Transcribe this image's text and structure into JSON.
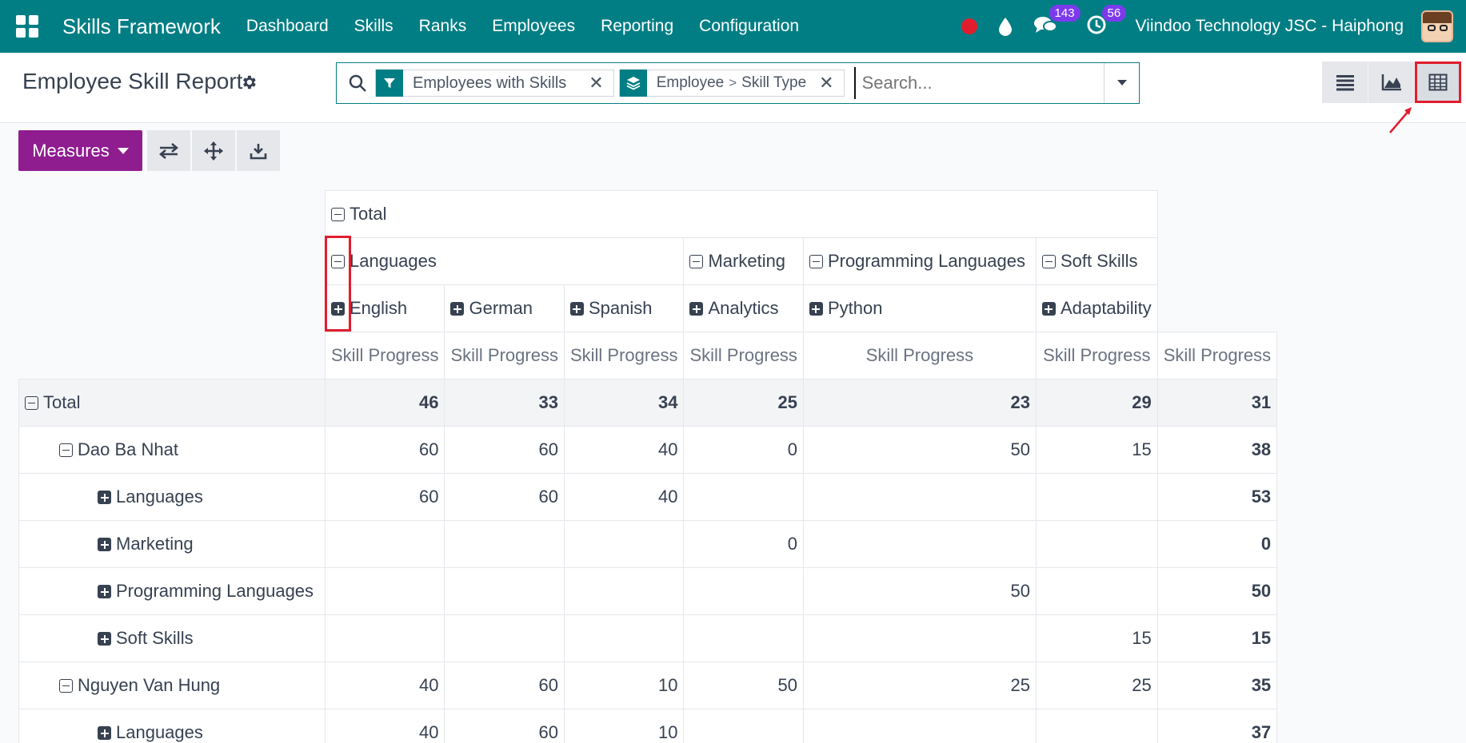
{
  "navbar": {
    "brand": "Skills Framework",
    "menu": [
      "Dashboard",
      "Skills",
      "Ranks",
      "Employees",
      "Reporting",
      "Configuration"
    ],
    "messages_badge": "143",
    "activities_badge": "56",
    "company": "Viindoo Technology JSC - Haiphong"
  },
  "control_panel": {
    "title": "Employee Skill Report",
    "facets": {
      "filter": "Employees with Skills",
      "groupby_first": "Employee",
      "groupby_separator": ">",
      "groupby_second": "Skill Type"
    },
    "search_placeholder": "Search...",
    "views": [
      "list-view-icon",
      "graph-view-icon",
      "pivot-view-icon"
    ],
    "active_view": "pivot"
  },
  "toolbar": {
    "measures_label": "Measures"
  },
  "pivot": {
    "header_total": "Total",
    "col_groups": [
      {
        "label": "Languages",
        "children": [
          "English",
          "German",
          "Spanish"
        ]
      },
      {
        "label": "Marketing",
        "children": [
          "Analytics"
        ]
      },
      {
        "label": "Programming Languages",
        "children": [
          "Python"
        ]
      },
      {
        "label": "Soft Skills",
        "children": [
          "Adaptability"
        ]
      }
    ],
    "measure": "Skill Progress",
    "rows": [
      {
        "label": "Total",
        "level": 0,
        "values": [
          "46",
          "33",
          "34",
          "25",
          "23",
          "29",
          "31"
        ]
      },
      {
        "label": "Dao Ba Nhat",
        "level": 1,
        "values": [
          "60",
          "60",
          "40",
          "0",
          "50",
          "15",
          "38"
        ]
      },
      {
        "label": "Languages",
        "level": 2,
        "values": [
          "60",
          "60",
          "40",
          "",
          "",
          "",
          "53"
        ]
      },
      {
        "label": "Marketing",
        "level": 2,
        "values": [
          "",
          "",
          "",
          "0",
          "",
          "",
          "0"
        ]
      },
      {
        "label": "Programming Languages",
        "level": 2,
        "values": [
          "",
          "",
          "",
          "",
          "50",
          "",
          "50"
        ]
      },
      {
        "label": "Soft Skills",
        "level": 2,
        "values": [
          "",
          "",
          "",
          "",
          "",
          "15",
          "15"
        ]
      },
      {
        "label": "Nguyen Van Hung",
        "level": 1,
        "values": [
          "40",
          "60",
          "10",
          "50",
          "25",
          "25",
          "35"
        ]
      },
      {
        "label": "Languages",
        "level": 2,
        "values": [
          "40",
          "60",
          "10",
          "",
          "",
          "",
          "37"
        ]
      }
    ]
  },
  "colors": {
    "navbar": "#017e84",
    "primary_button": "#8f1d8f",
    "highlight": "#e11d2d"
  }
}
